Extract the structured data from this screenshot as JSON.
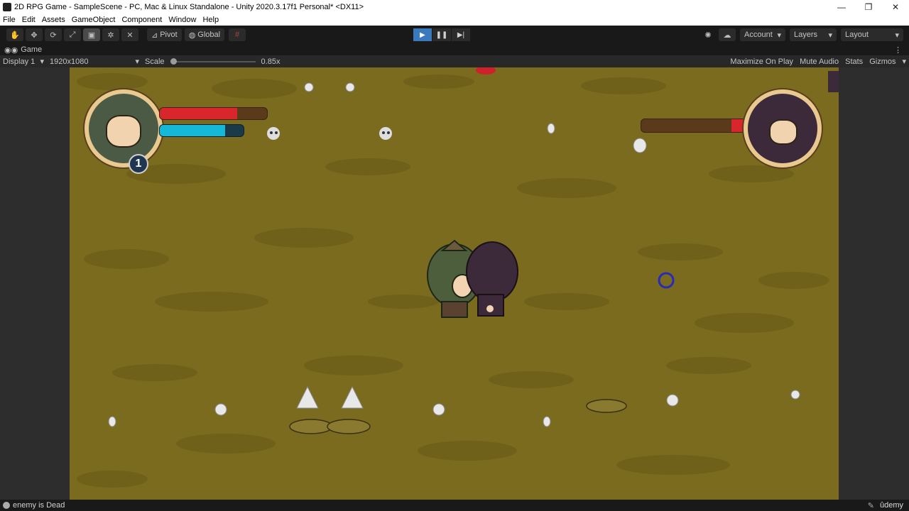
{
  "window": {
    "title": "2D RPG Game - SampleScene - PC, Mac & Linux Standalone - Unity 2020.3.17f1 Personal* <DX11>",
    "minimize": "—",
    "restore": "❐",
    "close": "✕"
  },
  "menu": [
    "File",
    "Edit",
    "Assets",
    "GameObject",
    "Component",
    "Window",
    "Help"
  ],
  "toolbar": {
    "pivot": "Pivot",
    "global": "Global",
    "account": "Account",
    "layers": "Layers",
    "layout": "Layout"
  },
  "game_tab": {
    "label": "Game",
    "display": "Display 1",
    "resolution": "1920x1080",
    "scale_label": "Scale",
    "scale_value": "0.85x",
    "maximize_on_play": "Maximize On Play",
    "mute_audio": "Mute Audio",
    "stats": "Stats",
    "gizmos": "Gizmos"
  },
  "hud": {
    "player_level": "1",
    "player_health": 0.72,
    "player_mana": 0.78,
    "enemy_health": 0.14
  },
  "status": {
    "message": "enemy is Dead",
    "watermark": "ûdemy"
  },
  "colors": {
    "ground": "#7a6b1f",
    "health": "#d9262c",
    "mana": "#16b8d8",
    "play_active": "#3a79bb"
  }
}
